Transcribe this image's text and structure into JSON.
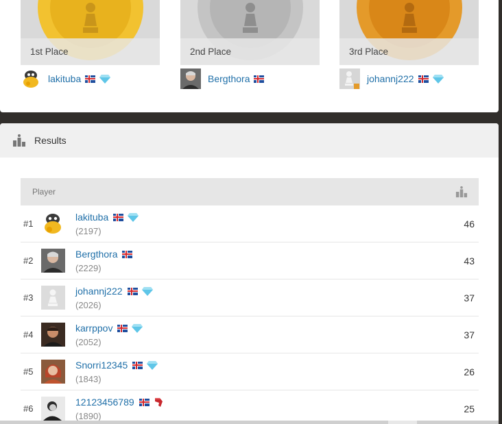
{
  "podium": [
    {
      "place_label": "1st Place",
      "username": "lakituba",
      "medal": "gold",
      "avatar": "lakitu-avatar",
      "flag": "iceland-flag",
      "badge": "diamond-icon"
    },
    {
      "place_label": "2nd Place",
      "username": "Bergthora",
      "medal": "silver",
      "avatar": "photo-avatar",
      "flag": "iceland-flag",
      "badge": null
    },
    {
      "place_label": "3rd Place",
      "username": "johannj222",
      "medal": "bronze",
      "avatar": "pawn-avatar",
      "flag": "iceland-flag",
      "badge": "diamond-icon"
    }
  ],
  "results": {
    "title": "Results",
    "icon": "podium-icon",
    "columns": {
      "player": "Player",
      "score_icon": "podium-icon"
    },
    "rows": [
      {
        "rank": "#1",
        "username": "lakituba",
        "rating": "(2197)",
        "score": "46",
        "badge": "diamond-icon"
      },
      {
        "rank": "#2",
        "username": "Bergthora",
        "rating": "(2229)",
        "score": "43",
        "badge": null
      },
      {
        "rank": "#3",
        "username": "johannj222",
        "rating": "(2026)",
        "score": "37",
        "badge": "diamond-icon"
      },
      {
        "rank": "#4",
        "username": "karrppov",
        "rating": "(2052)",
        "score": "37",
        "badge": "diamond-icon"
      },
      {
        "rank": "#5",
        "username": "Snorri12345",
        "rating": "(1843)",
        "score": "26",
        "badge": "diamond-icon"
      },
      {
        "rank": "#6",
        "username": "12123456789",
        "rating": "(1890)",
        "score": "25",
        "badge": "red-tag-icon"
      }
    ]
  },
  "colors": {
    "link": "#1f6fa8",
    "gold": "#f2c230",
    "silver": "#c4c4c4",
    "bronze": "#e49a2a",
    "background": "#312e2b"
  }
}
